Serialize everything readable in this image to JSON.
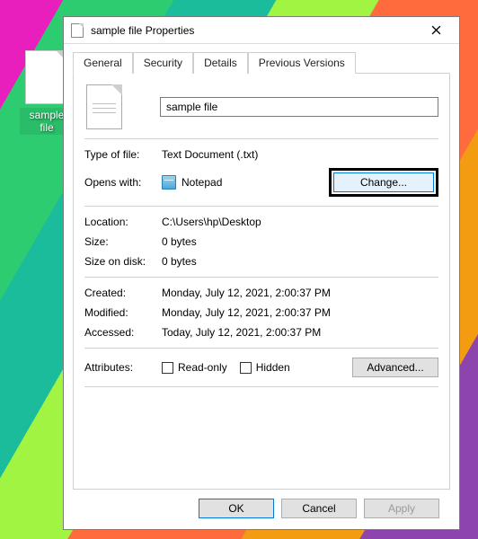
{
  "desktop": {
    "file_label": "sample file"
  },
  "dialog": {
    "title": "sample file Properties",
    "tabs": [
      "General",
      "Security",
      "Details",
      "Previous Versions"
    ],
    "filename": "sample file",
    "type_of_file": {
      "label": "Type of file:",
      "value": "Text Document (.txt)"
    },
    "opens_with": {
      "label": "Opens with:",
      "value": "Notepad",
      "change": "Change..."
    },
    "location": {
      "label": "Location:",
      "value": "C:\\Users\\hp\\Desktop"
    },
    "size": {
      "label": "Size:",
      "value": "0 bytes"
    },
    "size_on_disk": {
      "label": "Size on disk:",
      "value": "0 bytes"
    },
    "created": {
      "label": "Created:",
      "value": "Monday, July 12, 2021, 2:00:37 PM"
    },
    "modified": {
      "label": "Modified:",
      "value": "Monday, July 12, 2021, 2:00:37 PM"
    },
    "accessed": {
      "label": "Accessed:",
      "value": "Today, July 12, 2021, 2:00:37 PM"
    },
    "attributes": {
      "label": "Attributes:",
      "readonly": "Read-only",
      "hidden": "Hidden",
      "advanced": "Advanced..."
    },
    "buttons": {
      "ok": "OK",
      "cancel": "Cancel",
      "apply": "Apply"
    }
  }
}
